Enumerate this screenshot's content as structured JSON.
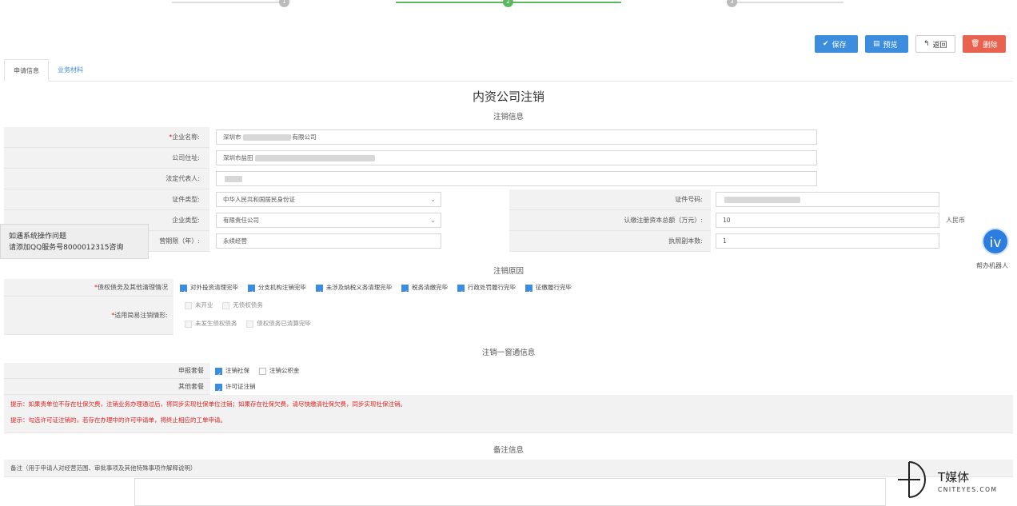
{
  "stepper": {
    "steps": [
      "1",
      "2",
      "3"
    ]
  },
  "toolbar": {
    "save": "保存",
    "preview": "预览",
    "back": "返回",
    "delete": "删除"
  },
  "tabs": [
    "申请信息",
    "业务材料"
  ],
  "page_title": "内资公司注销",
  "sections": {
    "cancel_info": "注销信息",
    "cancel_reason": "注销原因",
    "one_window": "注销一窗通信息",
    "remark": "备注信息"
  },
  "fields": {
    "company_name": {
      "label": "企业名称:",
      "value_prefix": "深圳市",
      "value_suffix": "有限公司"
    },
    "address": {
      "label": "公司住址:",
      "value_prefix": "深圳市盐田",
      "value_suffix": ""
    },
    "legal_rep": {
      "label": "法定代表人:",
      "value": ""
    },
    "id_type": {
      "label": "证件类型:",
      "value": "中华人民共和国居民身份证"
    },
    "id_number": {
      "label": "证件号码:",
      "value": ""
    },
    "company_type": {
      "label": "企业类型:",
      "value": "有限责任公司"
    },
    "registered_capital": {
      "label": "认缴注册资本总额（万元）:",
      "value": "10",
      "unit": "人民币"
    },
    "business_term": {
      "label": "营期限（年）:",
      "value": "永续经营"
    },
    "license_copies": {
      "label": "执照副本数:",
      "value": "1"
    }
  },
  "reason": {
    "debt_label": "债权债务及其他清理情况",
    "debt_items": [
      "对外投资清理完毕",
      "分支机构注销完毕",
      "未涉及纳税义务清理完毕",
      "税务清缴完毕",
      "行政处罚履行完毕",
      "征缴履行完毕"
    ],
    "simple_label": "适用简易注销情形:",
    "simple_items_row1": [
      "未开业",
      "无债权债务"
    ],
    "simple_items_row2": [
      "未发生债权债务",
      "债权债务已清算完毕"
    ]
  },
  "one_window": {
    "declare_label": "申报套餐",
    "declare_items": [
      {
        "label": "注销社保",
        "checked": true
      },
      {
        "label": "注销公积金",
        "checked": false
      }
    ],
    "other_label": "其他套餐",
    "other_items": [
      {
        "label": "许可证注销",
        "checked": true
      }
    ],
    "tip1": "提示：如果贵单位不存在社保欠费，注销业务办理通过后，将同步实现社保单位注销；如果存在社保欠费，请尽快缴清社保欠费，同步实现社保注销。",
    "tip2": "提示：勾选许可证注销的，若存在办理中的许可申请单，将终止相应的工单申请。"
  },
  "remark": {
    "label": "备注（用于申请人对经营范围、审批事项及其他特殊事项作解释说明）"
  },
  "float_note": {
    "line1": "如遇系统操作问题",
    "line2": "请添加QQ服务号800001231​5咨询"
  },
  "robot": {
    "glyph": "iv",
    "label": "帮办机器人"
  },
  "watermark": {
    "cn": "T媒体",
    "en": "CNITEYES.COM"
  },
  "colors": {
    "primary": "#3c8dde",
    "danger": "#e8634f",
    "success": "#5cb85c",
    "warning_text": "#e02020"
  }
}
